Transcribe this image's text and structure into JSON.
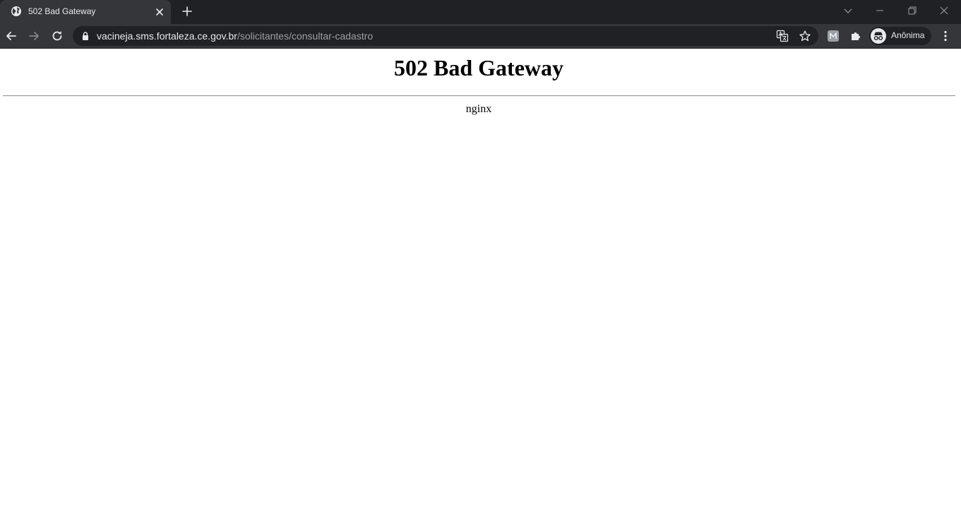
{
  "browser": {
    "tab": {
      "title": "502 Bad Gateway"
    },
    "address_bar": {
      "host": "vacineja.sms.fortaleza.ce.gov.br",
      "path": "/solicitantes/consultar-cadastro"
    },
    "profile": {
      "label": "Anônima"
    },
    "colors": {
      "tabstrip_bg": "#202124",
      "toolbar_bg": "#35363a",
      "omnibox_bg": "#202124",
      "text": "#e8eaed",
      "muted_text": "#9aa0a6"
    },
    "icons": [
      "globe-icon",
      "close-icon",
      "plus-icon",
      "chevron-down-icon",
      "minimize-icon",
      "restore-icon",
      "back-arrow-icon",
      "forward-arrow-icon",
      "reload-icon",
      "lock-icon",
      "translate-icon",
      "star-icon",
      "extension-m-icon",
      "puzzle-icon",
      "incognito-icon",
      "kebab-menu-icon"
    ]
  },
  "page": {
    "title": "502 Bad Gateway",
    "server": "nginx"
  }
}
